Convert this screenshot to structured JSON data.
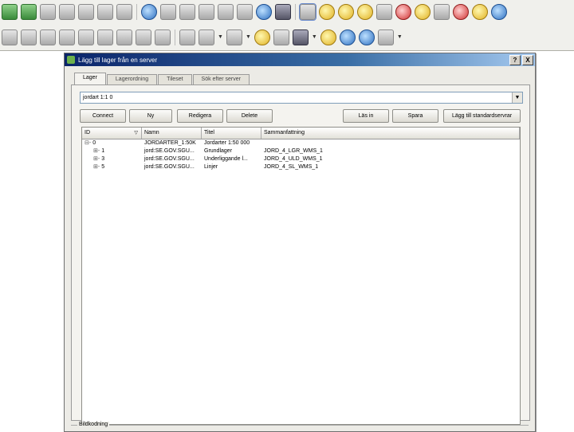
{
  "toolbar1": [
    "globe-icon",
    "globe-plus-icon",
    "crown-icon",
    "feather-icon",
    "tool-icon",
    "form-icon",
    "form2-icon",
    "gps-icon",
    "node-icon",
    "node2-icon",
    "node3-icon",
    "split-icon",
    "merge-icon",
    "globe-blue-icon",
    "layers-icon",
    "pan-icon",
    "pan-move-icon",
    "zoom-in-icon",
    "zoom-out-icon",
    "zoom-native-icon",
    "zoom-full-icon",
    "zoom-layer-icon",
    "zoom-select-icon",
    "zoom-last-icon",
    "zoom-next-icon",
    "refresh-icon"
  ],
  "toolbar2": [
    "info-icon",
    "select-icon",
    "measure-icon",
    "measure2-icon",
    "star-icon",
    "node-edit-icon",
    "polygon-icon",
    "polygon2-icon",
    "rotate-icon",
    "label-icon",
    "gear-icon",
    "pointer-icon",
    "no-icon",
    "table-icon",
    "ruler-icon",
    "tip-icon",
    "python-icon",
    "ogc-icon",
    "text-icon"
  ],
  "dialog": {
    "title": "Lägg till lager från en server",
    "help": "?",
    "close": "X"
  },
  "tabs": [
    "Lager",
    "Lagerordning",
    "Tileset",
    "Sök efter server"
  ],
  "connection": "jordart 1:1 0",
  "buttons": {
    "connect": "Connect",
    "new": "Ny",
    "edit": "Redigera",
    "delete": "Delete",
    "load": "Läs in",
    "save": "Spara",
    "add_default": "Lägg till standardservrar"
  },
  "columns": [
    "ID",
    "Namn",
    "Titel",
    "Sammanfattning"
  ],
  "rows": [
    {
      "tree": "⊟-",
      "id": "0",
      "name": "JORDARTER_1:50K",
      "title": "Jordarter 1:50 000",
      "summary": ""
    },
    {
      "tree": "⊞-",
      "id": "1",
      "name": "jord:SE.GOV.SGU...",
      "title": "Grundlager",
      "summary": "JORD_4_LGR_WMS_1"
    },
    {
      "tree": "⊞-",
      "id": "3",
      "name": "jord:SE.GOV.SGU...",
      "title": "Underliggande l...",
      "summary": "JORD_4_ULD_WMS_1"
    },
    {
      "tree": "⊞-",
      "id": "5",
      "name": "jord:SE.GOV.SGU...",
      "title": "Linjer",
      "summary": "JORD_4_SL_WMS_1"
    }
  ],
  "group_label": "Bildkodning"
}
